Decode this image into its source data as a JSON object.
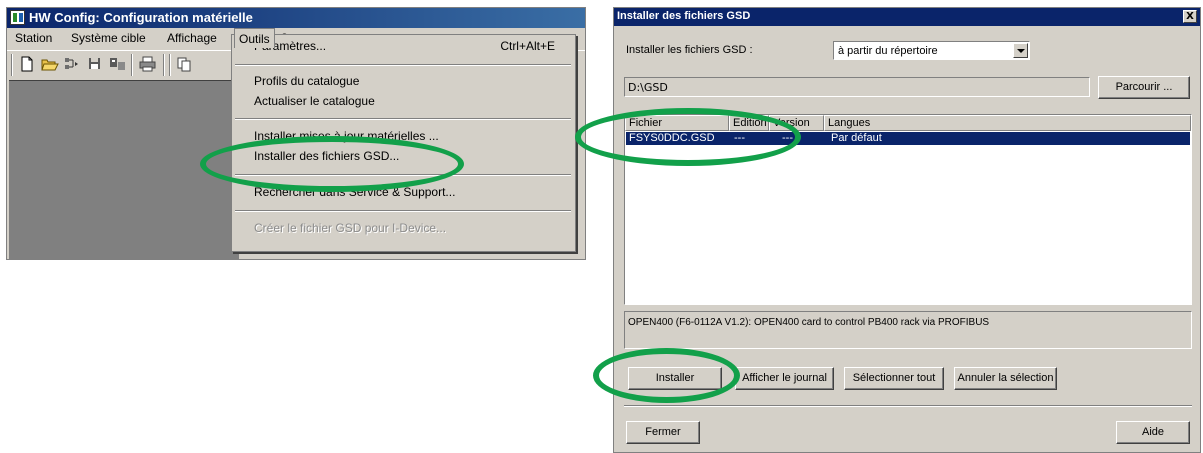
{
  "left_window": {
    "title": "HW Config: Configuration matérielle",
    "menu": [
      "Station",
      "Système cible",
      "Affichage",
      "Outils",
      "?"
    ],
    "toolbar_icons": [
      "new-file-icon",
      "open-folder-icon",
      "network-icon",
      "save-icon",
      "compile-icon",
      "print-icon",
      "copy-icon"
    ]
  },
  "outils_menu": {
    "items": [
      {
        "label": "Paramètres...",
        "shortcut": "Ctrl+Alt+E",
        "enabled": true
      },
      {
        "label": "Profils du catalogue",
        "enabled": true
      },
      {
        "label": "Actualiser le catalogue",
        "enabled": true
      },
      {
        "label": "Installer mises à jour matérielles ...",
        "enabled": true
      },
      {
        "label": "Installer des fichiers GSD...",
        "enabled": true
      },
      {
        "label": "Rechercher dans Service & Support...",
        "enabled": true
      },
      {
        "label": "Créer le fichier GSD pour  I-Device...",
        "enabled": false
      }
    ]
  },
  "dialog": {
    "title": "Installer des fichiers GSD",
    "close_symbol": "X",
    "install_from_label": "Installer les fichiers GSD :",
    "install_from_value": "à partir du répertoire",
    "path_value": "D:\\GSD",
    "browse_label": "Parcourir ...",
    "columns": [
      "Fichier",
      "Edition",
      "Version",
      "Langues"
    ],
    "rows": [
      {
        "file": "FSYS0DDC.GSD",
        "edition": "---",
        "version": "---",
        "languages": "Par défaut"
      }
    ],
    "description": "OPEN400 (F6-0112A V1.2): OPEN400 card to control PB400 rack via PROFIBUS",
    "buttons": {
      "install": "Installer",
      "show_log": "Afficher le journal",
      "select_all": "Sélectionner tout",
      "deselect": "Annuler la sélection",
      "close": "Fermer",
      "help": "Aide"
    }
  },
  "colors": {
    "highlight_ellipse": "#12a04a",
    "title_bar": "#0a246a",
    "selection": "#0a246a",
    "window_face": "#d4d0c8"
  }
}
